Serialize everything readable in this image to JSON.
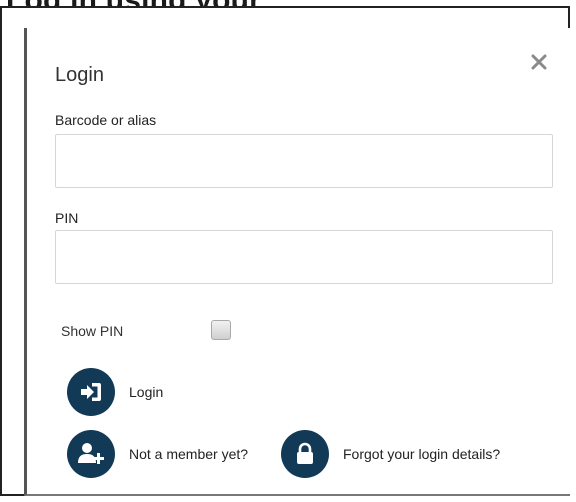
{
  "header_fragment": "Log in using your",
  "dialog": {
    "title": "Login",
    "close_label": "×"
  },
  "fields": {
    "barcode": {
      "label": "Barcode or alias",
      "value": "",
      "placeholder": ""
    },
    "pin": {
      "label": "PIN",
      "value": "",
      "placeholder": ""
    }
  },
  "show_pin": {
    "label": "Show PIN",
    "checked": false
  },
  "actions": {
    "login": {
      "label": "Login",
      "icon": "sign-in-icon"
    },
    "register": {
      "label": "Not a member yet?",
      "icon": "add-user-icon"
    },
    "forgot": {
      "label": "Forgot your login details?",
      "icon": "lock-icon"
    }
  },
  "colors": {
    "icon_bg": "#123a57",
    "icon_fg": "#ffffff"
  }
}
